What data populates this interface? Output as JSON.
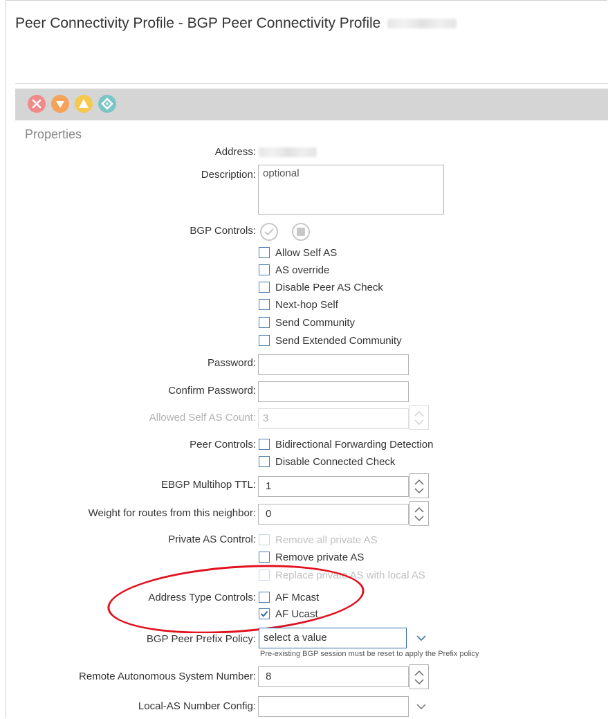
{
  "header": {
    "title": "Peer Connectivity Profile - BGP Peer Connectivity Profile"
  },
  "toolbar": {
    "faults": [
      {
        "icon": "critical-fault-icon",
        "color": "#f08a8a"
      },
      {
        "icon": "major-fault-icon",
        "color": "#f5a25a"
      },
      {
        "icon": "minor-fault-icon",
        "color": "#f5c84e"
      },
      {
        "icon": "warning-fault-icon",
        "color": "#7cc5c7"
      }
    ]
  },
  "properties": {
    "heading": "Properties",
    "address": {
      "label": "Address:"
    },
    "description": {
      "label": "Description:",
      "placeholder": "optional"
    },
    "bgp_controls": {
      "label": "BGP Controls:",
      "options": [
        {
          "label": "Allow Self AS",
          "checked": false
        },
        {
          "label": "AS override",
          "checked": false
        },
        {
          "label": "Disable Peer AS Check",
          "checked": false
        },
        {
          "label": "Next-hop Self",
          "checked": false
        },
        {
          "label": "Send Community",
          "checked": false
        },
        {
          "label": "Send Extended Community",
          "checked": false
        }
      ]
    },
    "password": {
      "label": "Password:",
      "value": ""
    },
    "confirm_password": {
      "label": "Confirm Password:",
      "value": ""
    },
    "allowed_self_as_count": {
      "label": "Allowed Self AS Count:",
      "value": "3"
    },
    "peer_controls": {
      "label": "Peer Controls:",
      "options": [
        {
          "label": "Bidirectional Forwarding Detection",
          "checked": false
        },
        {
          "label": "Disable Connected Check",
          "checked": false
        }
      ]
    },
    "ebgp_multihop_ttl": {
      "label": "EBGP Multihop TTL:",
      "value": "1"
    },
    "weight": {
      "label": "Weight for routes from this neighbor:",
      "value": "0"
    },
    "private_as_control": {
      "label": "Private AS Control:",
      "options": [
        {
          "label": "Remove all private AS",
          "checked": false,
          "disabled": true
        },
        {
          "label": "Remove private AS",
          "checked": false,
          "disabled": false
        },
        {
          "label": "Replace private AS with local AS",
          "checked": false,
          "disabled": true
        }
      ]
    },
    "address_type_controls": {
      "label": "Address Type Controls:",
      "options": [
        {
          "label": "AF Mcast",
          "checked": false
        },
        {
          "label": "AF Ucast",
          "checked": true
        }
      ]
    },
    "bgp_peer_prefix_policy": {
      "label": "BGP Peer Prefix Policy:",
      "value": "select a value",
      "hint": "Pre-existing BGP session must be reset to apply the Prefix policy"
    },
    "remote_as_number": {
      "label": "Remote Autonomous System Number:",
      "value": "8"
    },
    "local_as_number_config": {
      "label": "Local-AS Number Config:",
      "value": ""
    }
  },
  "colors": {
    "annotation": "#e0121f",
    "checkbox_border": "#4a7db2",
    "toolbar_bg": "#d5d5d5"
  }
}
